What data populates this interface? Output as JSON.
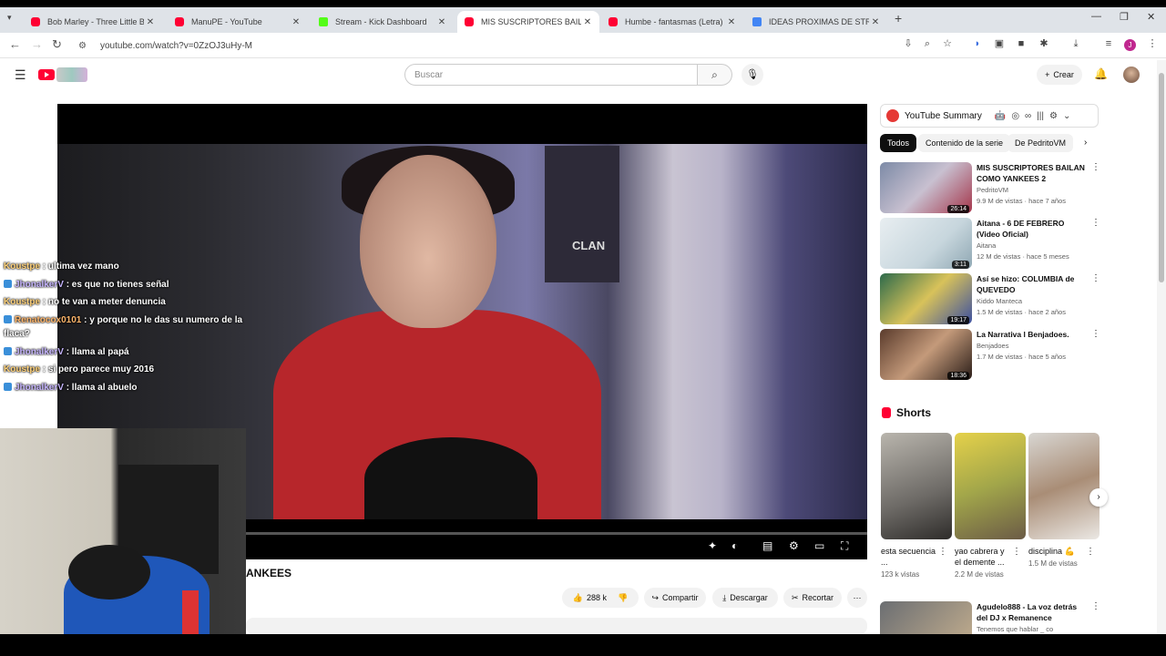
{
  "browser": {
    "tabs": [
      {
        "title": "Bob Marley - Three Little Birds",
        "icon": "youtube-icon"
      },
      {
        "title": "ManuPE - YouTube",
        "icon": "youtube-icon"
      },
      {
        "title": "Stream - Kick Dashboard",
        "icon": "kick-icon"
      },
      {
        "title": "MIS SUSCRIPTORES BAILAN CO",
        "icon": "youtube-icon"
      },
      {
        "title": "Humbe - fantasmas (Letra) - Yo",
        "icon": "youtube-icon"
      },
      {
        "title": "IDEAS PROXIMAS DE STREAM",
        "icon": "docs-icon"
      }
    ],
    "active_tab": 3,
    "url": "youtube.com/watch?v=0ZzOJ3uHy-M",
    "profile_initial": "J"
  },
  "youtube": {
    "search_placeholder": "Buscar",
    "create_label": "Crear"
  },
  "video": {
    "poster_text": "CLAN",
    "title_partial": "ANKEES",
    "likes": "288 k",
    "share_label": "Compartir",
    "download_label": "Descargar",
    "clip_label": "Recortar"
  },
  "chat": [
    {
      "user": "Koustpe",
      "message": ": ultima vez mano",
      "color": "gold"
    },
    {
      "user": "JhonalkerV",
      "message": ": es que no tienes señal",
      "color": "purple",
      "badge": true
    },
    {
      "user": "Koustpe",
      "message": ": no te van a meter denuncia",
      "color": "gold"
    },
    {
      "user": "Renatocox0101",
      "message": ": y porque no le das su numero de la flaca?",
      "color": "orange",
      "badge": true
    },
    {
      "user": "JhonalkerV",
      "message": ": llama al papá",
      "color": "purple",
      "badge": true
    },
    {
      "user": "Koustpe",
      "message": ": si pero parece muy 2016",
      "color": "gold"
    },
    {
      "user": "JhonalkerV",
      "message": ": llama al abuelo",
      "color": "purple",
      "badge": true
    }
  ],
  "sidebar": {
    "summary_label": "YouTube Summary",
    "chips": [
      "Todos",
      "Contenido de la serie",
      "De PedritoVM"
    ],
    "recommendations": [
      {
        "title": "MIS SUSCRIPTORES BAILAN COMO YANKEES 2",
        "channel": "PedritoVM",
        "meta": "9.9 M de vistas · hace 7 años",
        "duration": "26:14"
      },
      {
        "title": "Aitana - 6 DE FEBRERO (Video Oficial)",
        "channel": "Aitana",
        "meta": "12 M de vistas · hace 5 meses",
        "duration": "3:11"
      },
      {
        "title": "Así se hizo: COLUMBIA de QUEVEDO",
        "channel": "Kiddo Manteca",
        "meta": "1.5 M de vistas · hace 2 años",
        "duration": "19:17"
      },
      {
        "title": "La Narrativa l Benjadoes.",
        "channel": "Benjadoes",
        "meta": "1.7 M de vistas · hace 5 años",
        "duration": "18:36"
      }
    ],
    "shorts_label": "Shorts",
    "shorts": [
      {
        "title": "esta secuencia ...",
        "views": "123 k vistas"
      },
      {
        "title": "yao cabrera y el demente ...",
        "views": "2.2 M de vistas"
      },
      {
        "title": "disciplina 💪",
        "views": "1.5 M de vistas"
      }
    ],
    "next_item": {
      "title": "Agudelo888 - La voz detrás del DJ x Remanence",
      "channel": "Tenemos que hablar _ co"
    }
  }
}
